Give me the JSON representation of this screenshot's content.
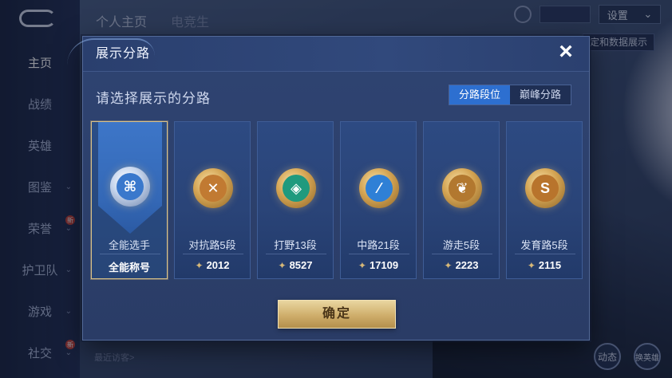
{
  "background": {
    "sidebar": [
      {
        "label": "主页",
        "active": true
      },
      {
        "label": "战绩"
      },
      {
        "label": "英雄"
      },
      {
        "label": "图鉴",
        "chevron": true
      },
      {
        "label": "荣誉",
        "chevron": true,
        "badge": "新"
      },
      {
        "label": "护卫队",
        "chevron": true
      },
      {
        "label": "游戏",
        "chevron": true
      },
      {
        "label": "社交",
        "chevron": true,
        "badge": "新"
      }
    ],
    "top_tabs": [
      "个人主页",
      "电竞生"
    ],
    "settings_label": "设置",
    "data_show_label": "定和数据展示",
    "recent_visitors_label": "最近访客>",
    "bottom_icons": [
      "动态",
      "换英雄"
    ]
  },
  "modal": {
    "title": "展示分路",
    "close_icon": "×",
    "subtitle": "请选择展示的分路",
    "toggle": {
      "options": [
        "分路段位",
        "巅峰分路"
      ],
      "selected": "分路段位"
    },
    "cards": [
      {
        "name": "全能选手",
        "sub": "全能称号",
        "selected": true,
        "icon": "all-round-emblem-icon",
        "glyph": "⌘",
        "color": "#3a78cc"
      },
      {
        "name": "对抗路5段",
        "score": "2012",
        "icon": "clash-lane-emblem-icon",
        "glyph": "✕",
        "color": "#c17a32"
      },
      {
        "name": "打野13段",
        "score": "8527",
        "icon": "jungle-emblem-icon",
        "glyph": "◈",
        "color": "#1f9a7e"
      },
      {
        "name": "中路21段",
        "score": "17109",
        "icon": "mid-lane-emblem-icon",
        "glyph": "⁄",
        "color": "#2f80d6"
      },
      {
        "name": "游走5段",
        "score": "2223",
        "icon": "roam-emblem-icon",
        "glyph": "❦",
        "color": "#b2782f"
      },
      {
        "name": "发育路5段",
        "score": "2115",
        "icon": "farm-lane-emblem-icon",
        "glyph": "S",
        "color": "#b8742c"
      }
    ],
    "confirm_label": "确定"
  }
}
